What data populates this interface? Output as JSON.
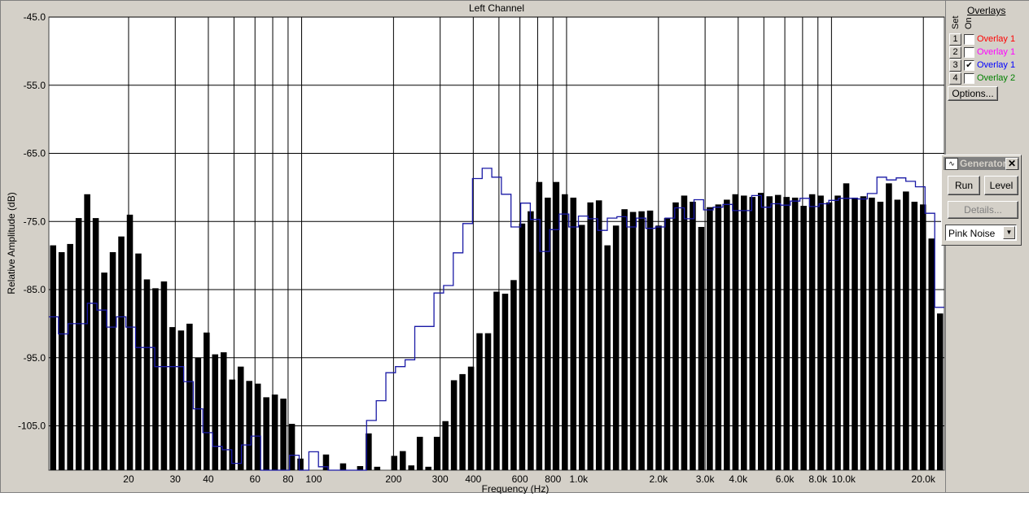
{
  "chart_data": {
    "type": "bar",
    "title": "Left Channel",
    "xlabel": "Frequency (Hz)",
    "ylabel": "Relative Amplitude (dB)",
    "x_scale": "log",
    "xlim": [
      10,
      24000
    ],
    "ylim": [
      -111.5,
      -45
    ],
    "y_ticks": [
      -45,
      -55,
      -65,
      -75,
      -85,
      -95,
      -105
    ],
    "y_tick_labels": [
      "-45.0",
      "-55.0",
      "-65.0",
      "-75.0",
      "-85.0",
      "-95.0",
      "-105.0"
    ],
    "x_tick_values": [
      20,
      30,
      40,
      60,
      80,
      100,
      200,
      300,
      400,
      600,
      800,
      1000,
      2000,
      3000,
      4000,
      6000,
      8000,
      10000,
      20000
    ],
    "x_tick_labels": [
      "20",
      "30",
      "40",
      "60",
      "80",
      "100",
      "200",
      "300",
      "400",
      "600",
      "800",
      "1.0k",
      "2.0k",
      "3.0k",
      "4.0k",
      "6.0k",
      "8.0k",
      "10.0k",
      "20.0k"
    ],
    "grid": true,
    "x": [
      10.0,
      11.2,
      12.6,
      14.1,
      15.8,
      17.8,
      20.0,
      22.4,
      25.1,
      28.2,
      31.6,
      35.5,
      39.8,
      44.7,
      50.1,
      56.2,
      63.1,
      70.8,
      79.4,
      89.1,
      100,
      112,
      126,
      141,
      158,
      178,
      200,
      224,
      251,
      282,
      316,
      355,
      398,
      447,
      501,
      562,
      631,
      708,
      794,
      891,
      1000,
      1122,
      1259,
      1413,
      1585,
      1778,
      1995,
      2239,
      2512,
      2818,
      3162,
      3548,
      3981,
      4467,
      5012,
      5623,
      6310,
      7079,
      7943,
      8913,
      10000,
      11220,
      12589,
      14125,
      15849,
      17783,
      19953,
      22387
    ],
    "series": [
      {
        "values": [
          -78.5,
          -79.5,
          -78.3,
          -74.5,
          -71,
          -74.5,
          -82.5,
          -79.5,
          -77.2,
          -74,
          -79.7,
          -83.5,
          -84.8,
          -83.8,
          -90.5,
          -91,
          -90,
          -95,
          -91.3,
          -94.5,
          -94.2,
          -98.2,
          -96.3,
          -98.4,
          -98.8,
          -100.8,
          -100.4,
          -101,
          -104.7,
          -109.8,
          -111.5,
          -111.5,
          -109.2,
          -111.5,
          -110.5,
          -111.5,
          -110.9,
          -106.1,
          -111,
          -111.5,
          -109.4,
          -108.7,
          -110.8,
          -106.6,
          -111,
          -106.6,
          -104.3,
          -98.3,
          -97.4,
          -96.3,
          -91.4,
          -91.4,
          -85.3,
          -85.6,
          -83.6,
          -75.3,
          -73.5,
          -69.2,
          -71.5,
          -69.2,
          -71,
          -71.5,
          -75.5,
          -72.2,
          -71.9,
          -78.5,
          -75.6,
          -73.2,
          -73.6,
          -73.5,
          -73.4,
          -75.6,
          -74.5,
          -72.2,
          -71.2,
          -72.1,
          -75.8,
          -72.9,
          -72.5,
          -71.8,
          -71,
          -71.2,
          -71.4,
          -70.8,
          -71.3,
          -71.1,
          -71.4,
          -71.5,
          -72.7,
          -71,
          -71.2,
          -72.2,
          -71.2,
          -69.4,
          -71.5,
          -71.3,
          -71.5,
          -72.1,
          -69.4,
          -71.8,
          -70.6,
          -72.1,
          -72.5,
          -77.5,
          -88.5
        ]
      },
      {
        "values": [
          -89,
          -91.5,
          -90,
          -90,
          -87,
          -88,
          -90.5,
          -89,
          -90.5,
          -93.5,
          -93.5,
          -96.3,
          -96.3,
          -96.3,
          -98.5,
          -102.5,
          -106,
          -108,
          -108.5,
          -110.5,
          -107.8,
          -106.5,
          -111.5,
          -111.5,
          -111.5,
          -109.3,
          -111.5,
          -108.8,
          -111,
          -111.5,
          -111.5,
          -111.5,
          -111.5,
          -104.2,
          -101.3,
          -97.2,
          -96.3,
          -95.3,
          -90.4,
          -90.4,
          -85.5,
          -84.4,
          -79.6,
          -75.3,
          -68.7,
          -67.2,
          -68.5,
          -71,
          -75.8,
          -72.3,
          -74.7,
          -79.4,
          -76.2,
          -73.9,
          -75.8,
          -74.2,
          -74.6,
          -76.3,
          -74.5,
          -74.3,
          -75.8,
          -74.5,
          -76,
          -75.8,
          -74.5,
          -73,
          -74.6,
          -71.8,
          -73.3,
          -72.9,
          -72.5,
          -73.4,
          -73.4,
          -71.2,
          -72.9,
          -72.4,
          -72.6,
          -72,
          -71.6,
          -72.8,
          -72.4,
          -71.9,
          -71.6,
          -71.6,
          -71.7,
          -70.9,
          -68.5,
          -68.9,
          -68.6,
          -69.1,
          -69.9,
          -73.8,
          -87.6
        ]
      }
    ]
  },
  "overlays": {
    "title": "Overlays",
    "set_label": "Set",
    "on_label": "On",
    "items": [
      {
        "num": "1",
        "checked": "",
        "label": "Overlay 1",
        "color": "#ff0000"
      },
      {
        "num": "2",
        "checked": "",
        "label": "Overlay 1",
        "color": "#ff00ff"
      },
      {
        "num": "3",
        "checked": "✔",
        "label": "Overlay 1",
        "color": "#0000ff"
      },
      {
        "num": "4",
        "checked": "",
        "label": "Overlay 2",
        "color": "#008000"
      }
    ],
    "options_label": "Options..."
  },
  "generator": {
    "title": "Generator",
    "icon": "waveform-icon",
    "close": "✕",
    "run_label": "Run",
    "level_label": "Level",
    "details_label": "Details...",
    "signal": "Pink Noise",
    "arrow": "▼"
  },
  "colors": {
    "bars": "#000000",
    "overlay_line": "#1a1aa6",
    "plot_bg": "#ffffff",
    "panel_bg": "#d4d0c8"
  }
}
